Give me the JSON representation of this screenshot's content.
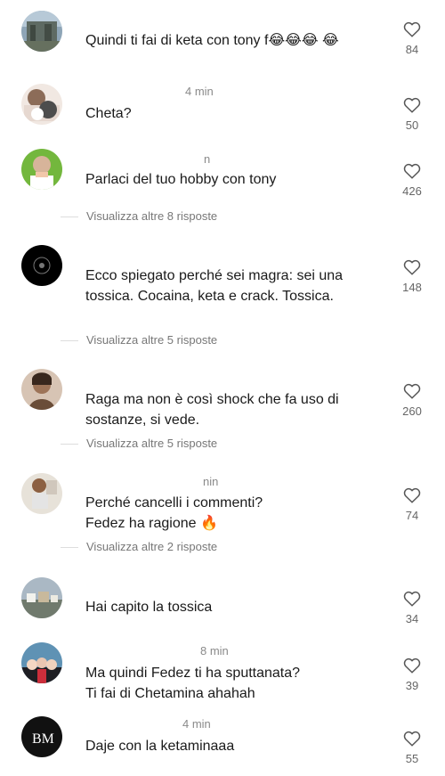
{
  "comments": [
    {
      "meta": "",
      "text": "Quindi ti fai di keta con tony f😂😂😂 😂",
      "likes": "84",
      "replies": ""
    },
    {
      "meta": "4 min",
      "text": "Cheta?",
      "likes": "50",
      "replies": ""
    },
    {
      "meta": "n",
      "text": "Parlaci del tuo hobby con tony",
      "likes": "426",
      "replies": "Visualizza altre 8 risposte"
    },
    {
      "meta": "",
      "text": "Ecco spiegato perché sei magra: sei una tossica. Cocaina, keta e crack. Tossica.",
      "likes": "148",
      "replies": "Visualizza altre 5 risposte"
    },
    {
      "meta": "",
      "text": "Raga ma non è così shock che fa uso di sostanze, si vede.",
      "likes": "260",
      "replies": "Visualizza altre 5 risposte"
    },
    {
      "meta": "nin",
      "text": "Perché cancelli i commenti? Fedez ha ragione 🔥",
      "likes": "74",
      "replies": "Visualizza altre 2 risposte"
    },
    {
      "meta": "",
      "text": "Hai capito la tossica",
      "likes": "34",
      "replies": ""
    },
    {
      "meta": "8 min",
      "text": "Ma quindi Fedez ti ha sputtanata? Ti fai di Chetamina ahahah",
      "likes": "39",
      "replies": ""
    },
    {
      "meta": "4 min",
      "text": "Daje con la ketaminaaa",
      "likes": "55",
      "replies": ""
    }
  ],
  "colors": {
    "text": "#1a1a1a",
    "meta": "#8a8a8a",
    "like_icon": "#555555"
  },
  "icons": {
    "like": "heart-outline-icon"
  }
}
